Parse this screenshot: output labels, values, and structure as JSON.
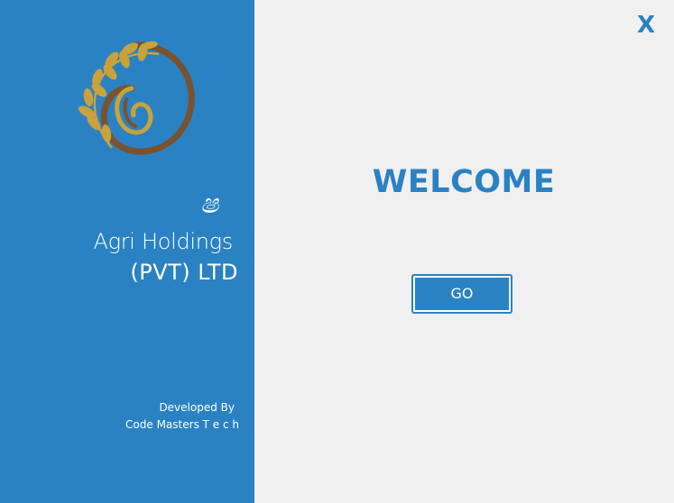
{
  "window": {
    "close_label": "X"
  },
  "brand": {
    "glyph": "ෂ",
    "company_line_1": "Agri Holdings",
    "company_line_2": "(PVT) LTD",
    "logo_icon": "wheat-spiral-logo-icon"
  },
  "footer": {
    "developed_by": "Developed By",
    "developer": "Code Masters T e c h"
  },
  "main": {
    "title": "WELCOME",
    "go_label": "GO"
  },
  "colors": {
    "accent_blue": "#2a82c3",
    "background": "#f0f0f0",
    "logo_gold": "#c9a23c",
    "logo_brown": "#7a5230"
  }
}
